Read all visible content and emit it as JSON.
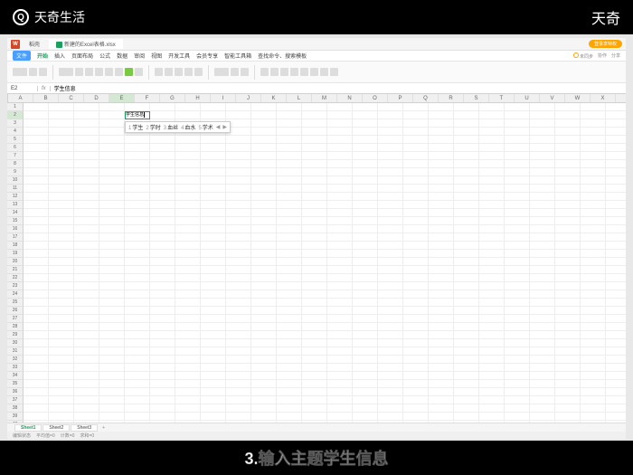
{
  "brand": {
    "name": "天奇生活"
  },
  "top_right": "天奇",
  "tabs": {
    "home": "稻壳",
    "doc": "新建的Excel表格.xlsx"
  },
  "login_btn": "登录享特权",
  "menu": {
    "file": "文件",
    "items": [
      "开始",
      "插入",
      "页面布局",
      "公式",
      "数据",
      "审阅",
      "视图",
      "开发工具",
      "会员专享",
      "智能工具箱"
    ],
    "search": "查找命令、搜索模板",
    "sync": "未同步",
    "coop": "协作",
    "share": "分享"
  },
  "formula": {
    "cell": "E2",
    "value": "学生信息"
  },
  "cell_content": "学生信息",
  "columns": [
    "A",
    "B",
    "C",
    "D",
    "E",
    "F",
    "G",
    "H",
    "I",
    "J",
    "K",
    "L",
    "M",
    "N",
    "O",
    "P",
    "Q",
    "R",
    "S",
    "T",
    "U",
    "V",
    "W",
    "X",
    "Y"
  ],
  "ime": {
    "candidates": [
      {
        "n": "1",
        "t": "学生"
      },
      {
        "n": "2",
        "t": "学时"
      },
      {
        "n": "3",
        "t": "血丝"
      },
      {
        "n": "4",
        "t": "血水"
      },
      {
        "n": "5",
        "t": "学术"
      }
    ]
  },
  "sheets": {
    "s1": "Sheet1",
    "s2": "Sheet2",
    "s3": "Sheet3"
  },
  "status": {
    "mode": "编辑状态",
    "avg": "平均值=0",
    "cnt": "计数=0",
    "sum": "求和=0"
  },
  "caption": "3.输入主题学生信息"
}
